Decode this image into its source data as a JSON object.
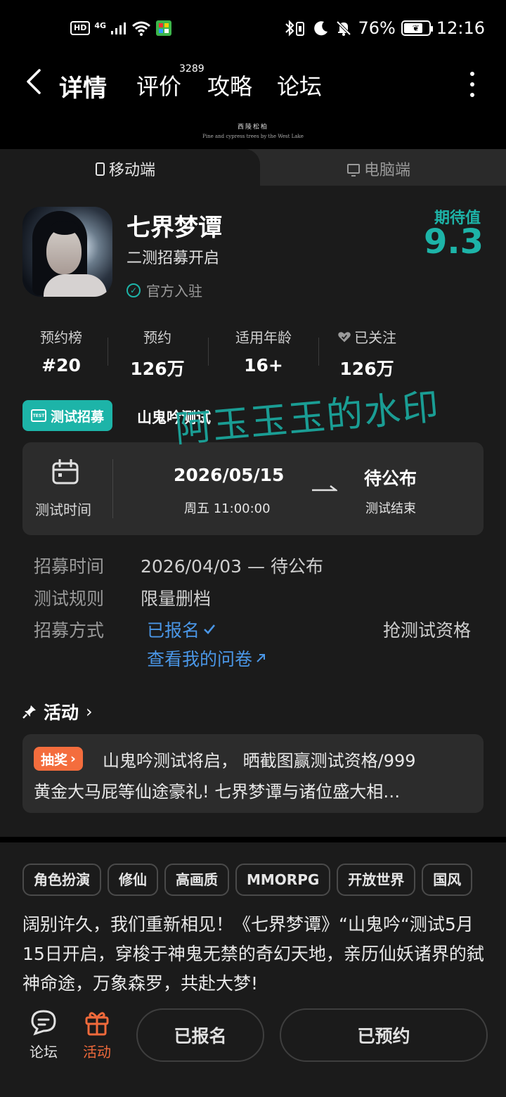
{
  "status_bar": {
    "hd": "HD",
    "network": "4G",
    "battery_percent": "76%",
    "battery_level": 0.76,
    "time": "12:16"
  },
  "nav": {
    "tabs": [
      {
        "label": "详情",
        "active": true
      },
      {
        "label": "评价",
        "badge": "3289"
      },
      {
        "label": "攻略"
      },
      {
        "label": "论坛"
      }
    ],
    "accent_color": "#1db4a8"
  },
  "banner": {
    "title": "西陵松柏",
    "subtitle": "Pine and cypress trees by the West Lake"
  },
  "platform_tabs": {
    "mobile": "移动端",
    "pc": "电脑端"
  },
  "game": {
    "title": "七界梦谭",
    "subtitle": "二测招募开启",
    "official": "官方入驻",
    "expect_label": "期待值",
    "expect_score": "9.3"
  },
  "stats": [
    {
      "label": "预约榜",
      "value": "#20"
    },
    {
      "label": "预约",
      "value": "126万"
    },
    {
      "label": "适用年龄",
      "value": "16+"
    },
    {
      "label": "已关注",
      "value": "126万",
      "icon": "heart-icon"
    }
  ],
  "recruit": {
    "badge": "测试招募",
    "badge_icon_text": "TEST",
    "name": "山鬼吟测试"
  },
  "test_card": {
    "label": "测试时间",
    "start_date": "2026/05/15",
    "start_sub": "周五  11:00:00",
    "end_date": "待公布",
    "end_sub": "测试结束"
  },
  "info": {
    "recruit_time_key": "招募时间",
    "recruit_time_val": "2026/04/03 — 待公布",
    "rule_key": "测试规则",
    "rule_val": "限量删档",
    "method_key": "招募方式",
    "registered": "已报名",
    "questionnaire": "查看我的问卷",
    "grab": "抢测试资格"
  },
  "activity": {
    "heading": "活动",
    "badge": "抽奖",
    "line1": "山鬼吟测试将启， 晒截图赢测试资格/999",
    "line2": "黄金大马屁等仙途豪礼! 七界梦谭与诸位盛大相…"
  },
  "tags": [
    "角色扮演",
    "修仙",
    "高画质",
    "MMORPG",
    "开放世界",
    "国风"
  ],
  "description": "阔别许久，我们重新相见！《七界梦谭》“山鬼吟“测试5月15日开启，穿梭于神鬼无禁的奇幻天地，亲历仙妖诸界的弑神命途，万象森罗，共赴大梦!",
  "bottom_nav": {
    "forum": "论坛",
    "activity": "活动",
    "registered_btn": "已报名",
    "reserved_btn": "已预约"
  },
  "watermark": "阿玉玉玉的水印"
}
